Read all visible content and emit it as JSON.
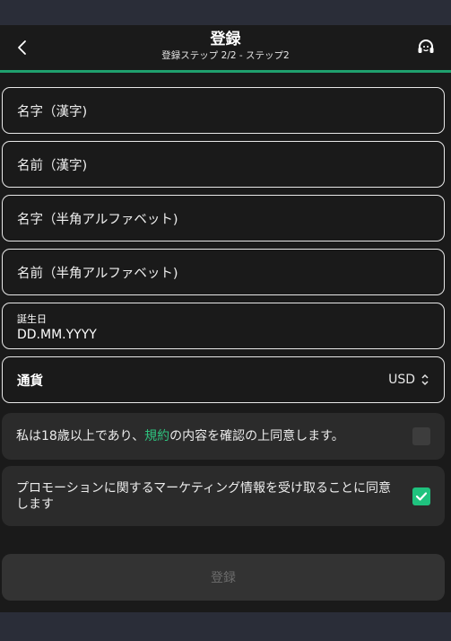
{
  "header": {
    "title": "登録",
    "subtitle": "登録ステップ 2/2 - ステップ2",
    "back_icon": "chevron-left-icon",
    "support_icon": "headset-icon"
  },
  "fields": {
    "last_name_kanji": "名字（漢字)",
    "first_name_kanji": "名前（漢字)",
    "last_name_latin": "名字（半角アルファベット)",
    "first_name_latin": "名前（半角アルファベット)",
    "dob_label": "誕生日",
    "dob_placeholder": "DD.MM.YYYY"
  },
  "currency": {
    "label": "通貨",
    "value": "USD"
  },
  "consents": {
    "age_before": "私は18歳以上であり、",
    "age_link": "規約",
    "age_after": "の内容を確認の上同意します。",
    "age_checked": false,
    "marketing": "プロモーションに関するマーケティング情報を受け取ることに同意します",
    "marketing_checked": true
  },
  "submit_label": "登録",
  "colors": {
    "accent": "#1fa06e",
    "link": "#2ec27e",
    "background": "#1a1a1a",
    "band": "#2a2d38"
  }
}
